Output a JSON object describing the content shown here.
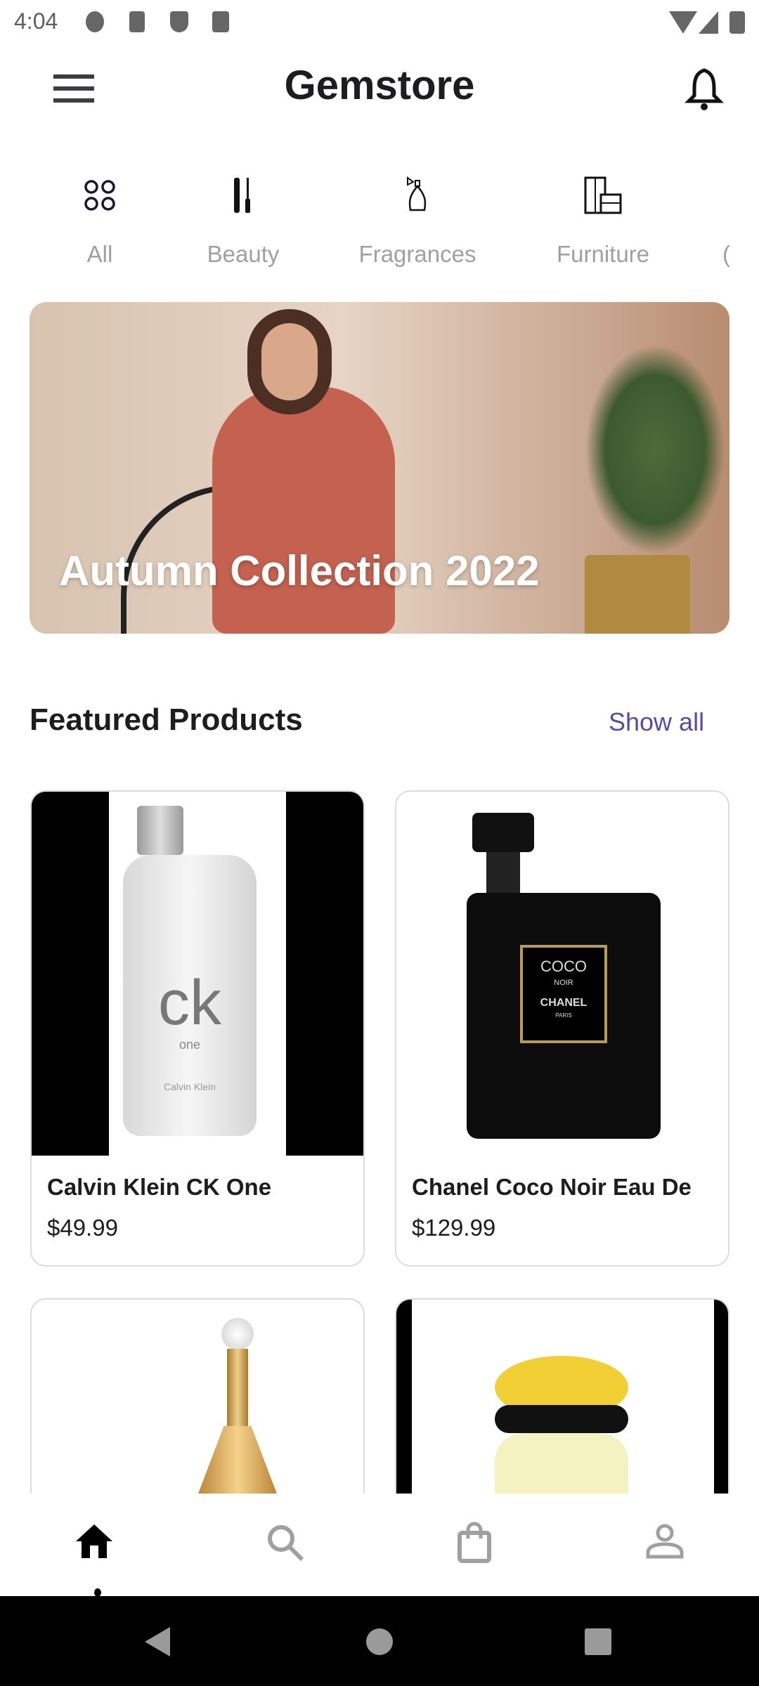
{
  "status_bar": {
    "time": "4:04",
    "icons": [
      "settings-icon",
      "a-icon",
      "shield-play-icon",
      "sd-card-icon",
      "wifi-icon",
      "signal-icon",
      "battery-icon"
    ]
  },
  "header": {
    "title": "Gemstore",
    "menu_icon": "menu-icon",
    "notification_icon": "bell-icon"
  },
  "categories": [
    {
      "label": "All",
      "icon": "grid-circles-icon",
      "active": false
    },
    {
      "label": "Beauty",
      "icon": "mascara-icon",
      "active": false
    },
    {
      "label": "Fragrances",
      "icon": "perfume-bottle-icon",
      "active": true
    },
    {
      "label": "Furniture",
      "icon": "wardrobe-icon",
      "active": false
    },
    {
      "label": "(",
      "icon": "",
      "active": false
    }
  ],
  "banner": {
    "title": "Autumn Collection 2022"
  },
  "featured": {
    "title": "Featured Products",
    "show_all": "Show all",
    "accent": "#5b4aa5",
    "products": [
      {
        "name": "Calvin Klein CK One",
        "price": "$49.99",
        "bottle_text": "ck",
        "bottle_sub": "one",
        "bottle_brand": "Calvin Klein"
      },
      {
        "name": "Chanel Coco Noir Eau De",
        "price": "$129.99",
        "label1": "COCO",
        "label2": "NOIR",
        "label3": "CHANEL",
        "label4": "PARIS"
      },
      {
        "name": "",
        "price": ""
      },
      {
        "name": "",
        "price": ""
      }
    ]
  },
  "bottom_nav": [
    {
      "icon": "home-icon",
      "active": true
    },
    {
      "icon": "search-icon",
      "active": false
    },
    {
      "icon": "shopping-bag-icon",
      "active": false
    },
    {
      "icon": "profile-icon",
      "active": false
    }
  ],
  "system_nav": [
    "back-icon",
    "home-circle-icon",
    "recents-icon"
  ]
}
